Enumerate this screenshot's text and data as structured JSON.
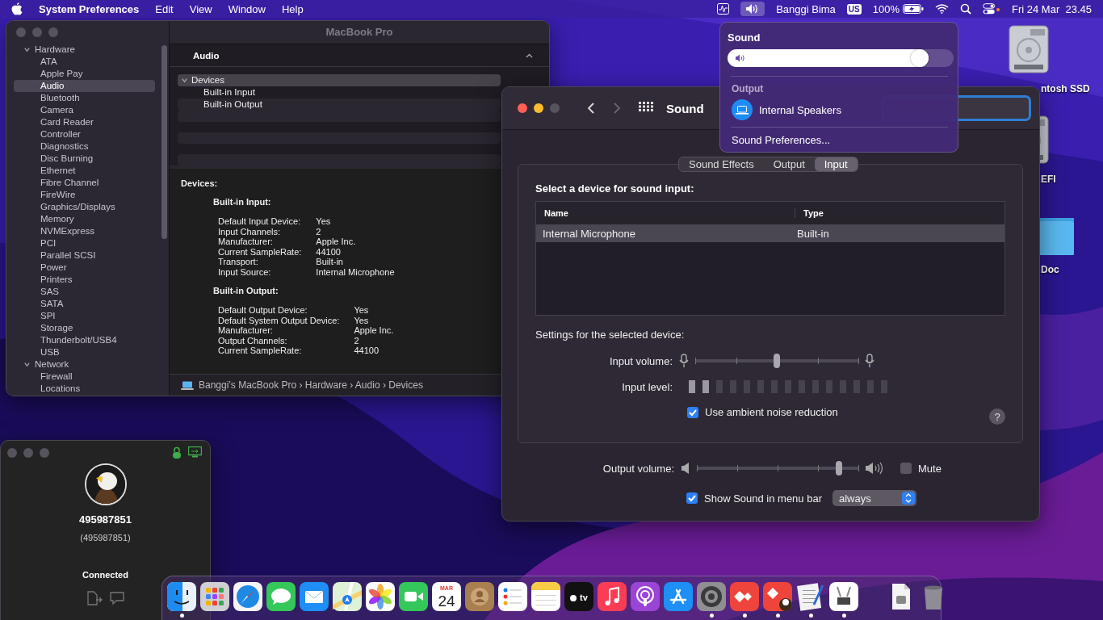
{
  "menu_bar": {
    "app_name": "System Preferences",
    "menus": [
      "Edit",
      "View",
      "Window",
      "Help"
    ],
    "sound_menu_open": true,
    "user": "Banggi Bima",
    "input_source": "US",
    "battery": "100%",
    "clock": "Fri 24 Mar  23.45"
  },
  "desktop_icons": [
    {
      "label": "ntosh SSD",
      "kind": "drive"
    },
    {
      "label": "EFI",
      "kind": "drive"
    },
    {
      "label": "Doc",
      "kind": "folder"
    }
  ],
  "system_information": {
    "window": {
      "title": "MacBook Pro"
    },
    "sidebar": {
      "items": [
        {
          "label": "Hardware",
          "expanded": true,
          "selected": false,
          "children": [
            {
              "label": "ATA",
              "selected": false
            },
            {
              "label": "Apple Pay",
              "selected": false
            },
            {
              "label": "Audio",
              "selected": true
            },
            {
              "label": "Bluetooth",
              "selected": false
            },
            {
              "label": "Camera",
              "selected": false
            },
            {
              "label": "Card Reader",
              "selected": false
            },
            {
              "label": "Controller",
              "selected": false
            },
            {
              "label": "Diagnostics",
              "selected": false
            },
            {
              "label": "Disc Burning",
              "selected": false
            },
            {
              "label": "Ethernet",
              "selected": false
            },
            {
              "label": "Fibre Channel",
              "selected": false
            },
            {
              "label": "FireWire",
              "selected": false
            },
            {
              "label": "Graphics/Displays",
              "selected": false
            },
            {
              "label": "Memory",
              "selected": false
            },
            {
              "label": "NVMExpress",
              "selected": false
            },
            {
              "label": "PCI",
              "selected": false
            },
            {
              "label": "Parallel SCSI",
              "selected": false
            },
            {
              "label": "Power",
              "selected": false
            },
            {
              "label": "Printers",
              "selected": false
            },
            {
              "label": "SAS",
              "selected": false
            },
            {
              "label": "SATA",
              "selected": false
            },
            {
              "label": "SPI",
              "selected": false
            },
            {
              "label": "Storage",
              "selected": false
            },
            {
              "label": "Thunderbolt/USB4",
              "selected": false
            },
            {
              "label": "USB",
              "selected": false
            }
          ]
        },
        {
          "label": "Network",
          "expanded": true,
          "selected": false,
          "children": [
            {
              "label": "Firewall",
              "selected": false
            },
            {
              "label": "Locations",
              "selected": false
            }
          ]
        }
      ]
    },
    "header": "Audio",
    "tree": [
      {
        "label": "Devices",
        "expanded": true,
        "selected": true,
        "children": [
          {
            "label": "Built-in Input",
            "selected": false
          },
          {
            "label": "Built-in Output",
            "selected": false
          }
        ]
      }
    ],
    "details": {
      "title": "Devices:",
      "sections": [
        {
          "title": "Built-in Input:",
          "rows": [
            {
              "key": "Default Input Device:",
              "value": "Yes"
            },
            {
              "key": "Input Channels:",
              "value": "2"
            },
            {
              "key": "Manufacturer:",
              "value": "Apple Inc."
            },
            {
              "key": "Current SampleRate:",
              "value": "44100"
            },
            {
              "key": "Transport:",
              "value": "Built-in"
            },
            {
              "key": "Input Source:",
              "value": "Internal Microphone"
            }
          ]
        },
        {
          "title": "Built-in Output:",
          "rows": [
            {
              "key": "Default Output Device:",
              "value": "Yes"
            },
            {
              "key": "Default System Output Device:",
              "value": "Yes"
            },
            {
              "key": "Manufacturer:",
              "value": "Apple Inc."
            },
            {
              "key": "Output Channels:",
              "value": "2"
            },
            {
              "key": "Current SampleRate:",
              "value": "44100"
            }
          ]
        }
      ]
    },
    "path": "Banggi’s MacBook Pro › Hardware › Audio › Devices"
  },
  "remote_window": {
    "id": "495987851",
    "alias": "(495987851)",
    "status": "Connected"
  },
  "sound_preferences": {
    "window": {
      "title": "Sound"
    },
    "tabs": [
      {
        "label": "Sound Effects",
        "selected": false
      },
      {
        "label": "Output",
        "selected": false
      },
      {
        "label": "Input",
        "selected": true
      }
    ],
    "device_prompt": "Select a device for sound input:",
    "device_table": {
      "columns": [
        "Name",
        "Type"
      ],
      "rows": [
        {
          "cells": [
            "Internal Microphone",
            "Built-in"
          ],
          "selected": true
        }
      ]
    },
    "settings_heading": "Settings for the selected device:",
    "input_volume": {
      "label": "Input volume:",
      "level": 0.5
    },
    "input_level": {
      "label": "Input level:",
      "level": 0.13
    },
    "noise_reduction": {
      "label": "Use ambient noise reduction",
      "checked": true
    },
    "help_button": "?",
    "output_volume": {
      "label": "Output volume:",
      "level": 0.88
    },
    "mute": {
      "label": "Mute",
      "checked": false
    },
    "show_in_menu_bar": {
      "label": "Show Sound in menu bar",
      "checked": true
    },
    "show_mode": {
      "value": "always"
    }
  },
  "sound_menu": {
    "title": "Sound",
    "volume": {
      "level": 0.89
    },
    "output_heading": "Output",
    "devices": [
      {
        "name": "Internal Speakers",
        "selected": true
      }
    ],
    "preferences_item": "Sound Preferences..."
  },
  "dock": {
    "items": [
      {
        "kind": "finder",
        "running": true
      },
      {
        "kind": "launchpad",
        "running": false
      },
      {
        "kind": "safari",
        "running": false
      },
      {
        "kind": "messages",
        "running": false
      },
      {
        "kind": "mail",
        "running": false
      },
      {
        "kind": "maps",
        "running": false
      },
      {
        "kind": "photos",
        "running": false
      },
      {
        "kind": "facetime",
        "running": false
      },
      {
        "kind": "calendar",
        "running": false,
        "month": "MAR",
        "day": "24"
      },
      {
        "kind": "contacts",
        "running": false
      },
      {
        "kind": "reminders",
        "running": false
      },
      {
        "kind": "notes",
        "running": false
      },
      {
        "kind": "tv",
        "running": false,
        "label": "tv"
      },
      {
        "kind": "music",
        "running": false
      },
      {
        "kind": "podcasts",
        "running": false
      },
      {
        "kind": "appstore",
        "running": false
      },
      {
        "kind": "settings",
        "running": true
      },
      {
        "kind": "remote",
        "running": true
      },
      {
        "kind": "remote_badge",
        "running": true
      },
      {
        "kind": "editor",
        "running": true
      },
      {
        "kind": "utility",
        "running": true
      },
      {
        "kind": "separator"
      },
      {
        "kind": "document",
        "running": false
      },
      {
        "kind": "trash",
        "running": false
      }
    ]
  }
}
